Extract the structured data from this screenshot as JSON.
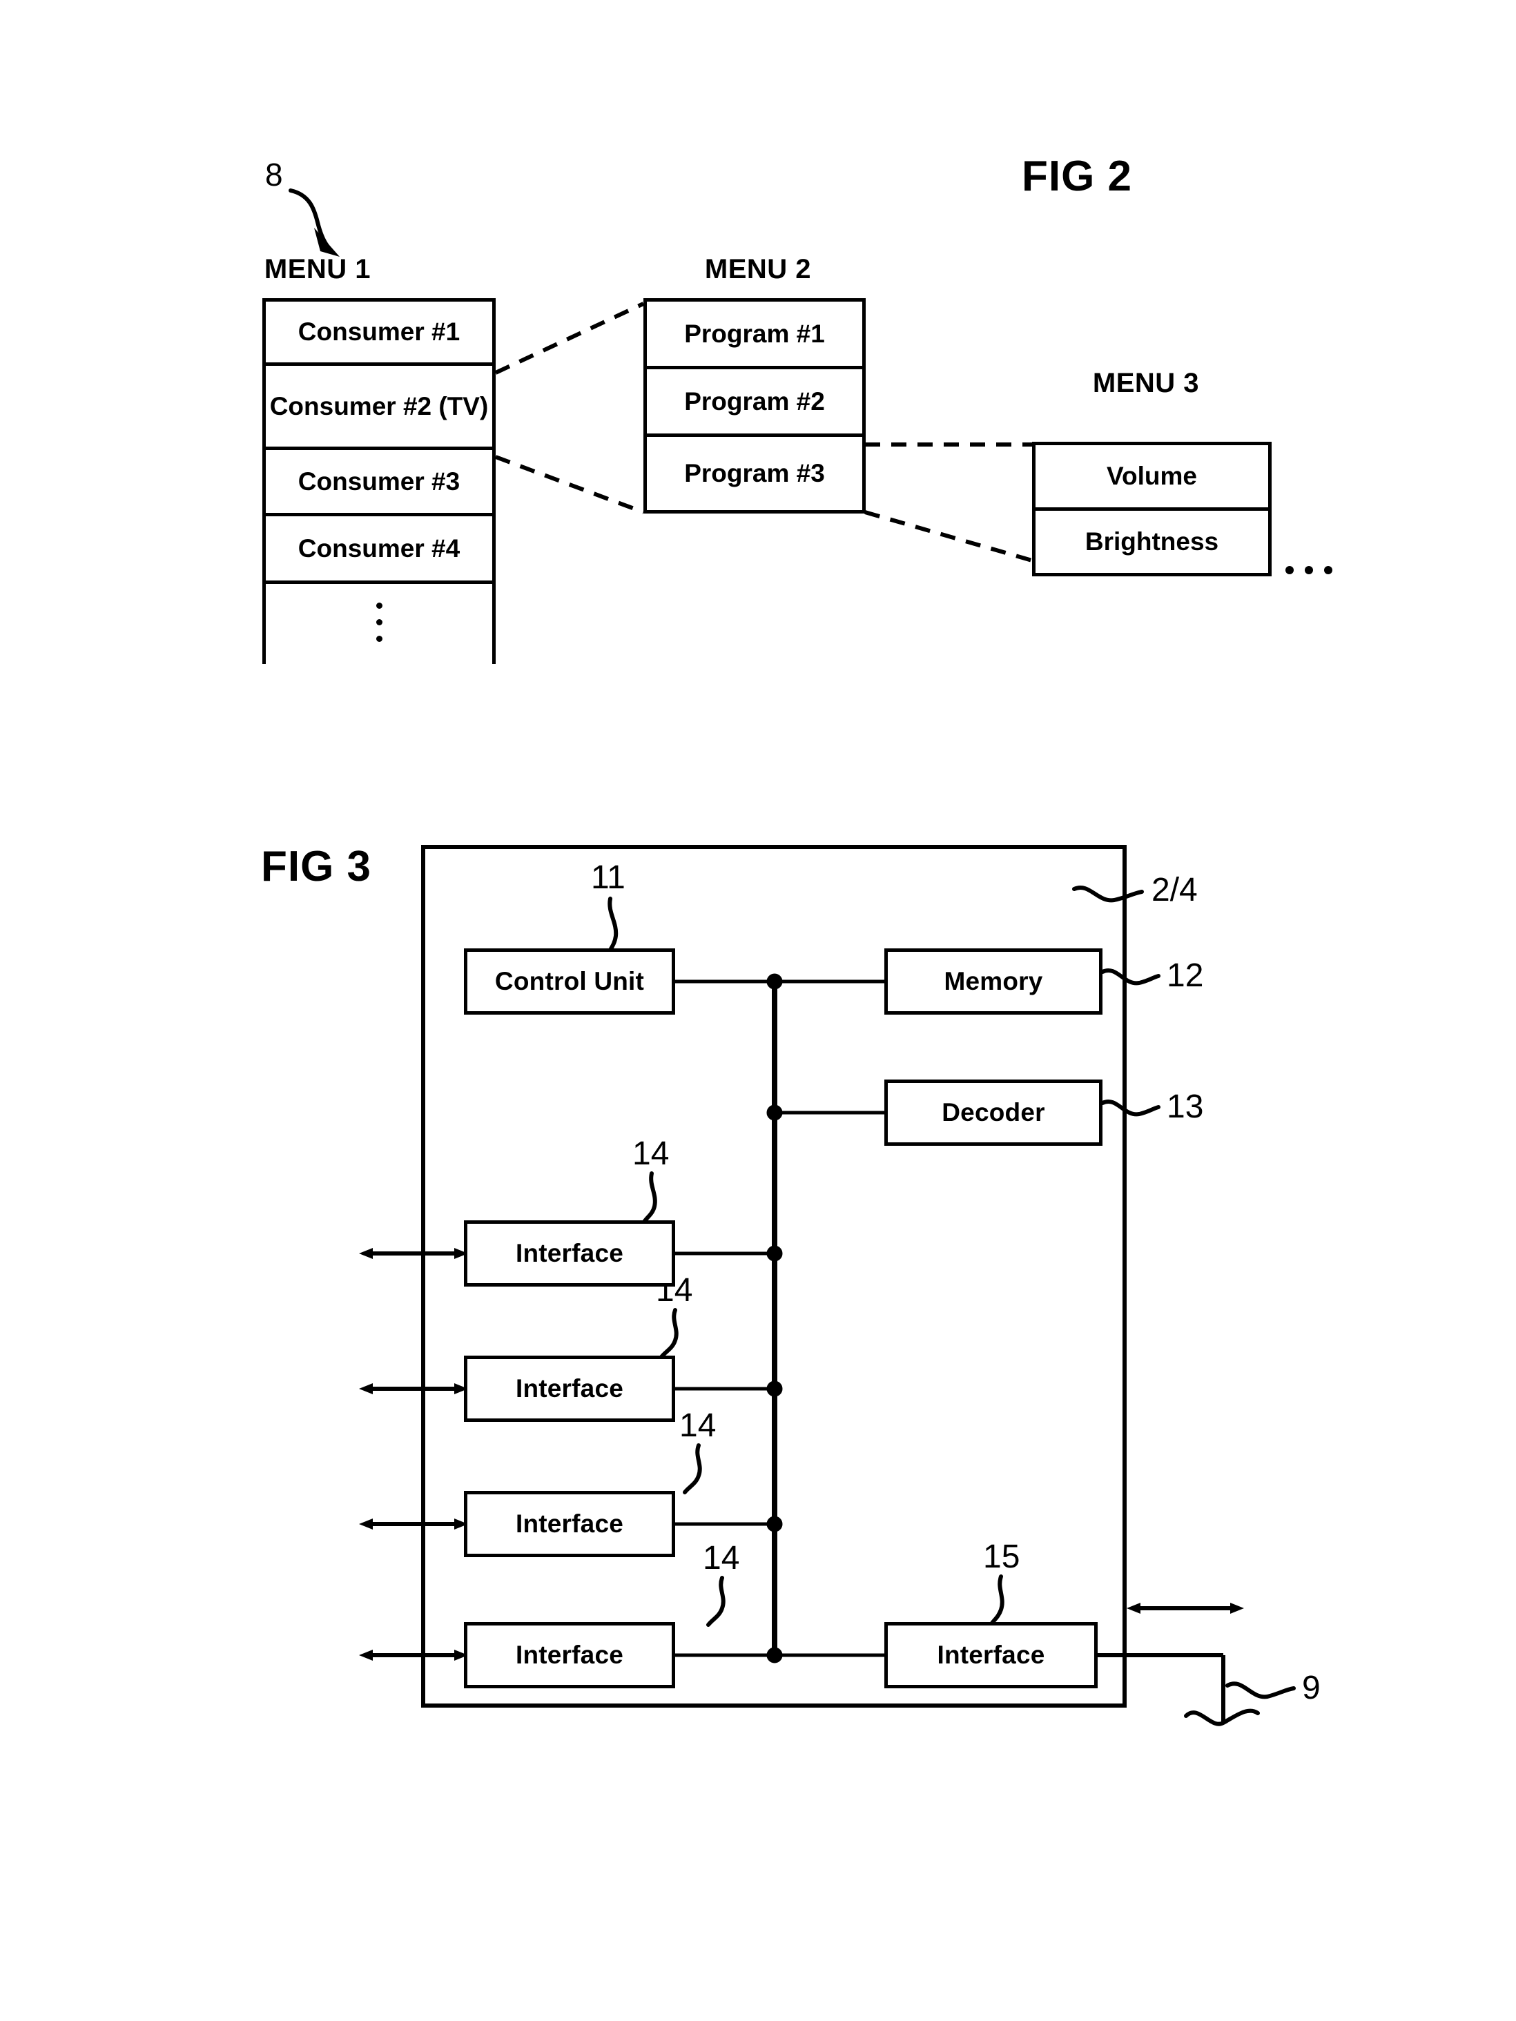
{
  "figures": [
    {
      "id": "fig2",
      "label": "FIG 2",
      "lead_ref": "8"
    },
    {
      "id": "fig3",
      "label": "FIG 3"
    }
  ],
  "fig2": {
    "label": "FIG 2",
    "lead_ref": "8",
    "menus": [
      {
        "title": "MENU 1",
        "items": [
          "Consumer #1",
          "Consumer #2\n(TV)",
          "Consumer #3",
          "Consumer #4"
        ],
        "continues": true,
        "continuation_glyph": "vertical-ellipsis"
      },
      {
        "title": "MENU 2",
        "items": [
          "Program #1",
          "Program #2",
          "Program #3"
        ],
        "continues": false
      },
      {
        "title": "MENU 3",
        "items": [
          "Volume",
          "Brightness"
        ],
        "continues": true,
        "continuation_glyph": "horizontal-ellipsis"
      }
    ]
  },
  "fig3": {
    "label": "FIG 3",
    "enclosure_ref": "2/4",
    "external_bus_ref": "9",
    "blocks": [
      {
        "name": "control-unit",
        "label": "Control Unit",
        "ref": "11"
      },
      {
        "name": "memory",
        "label": "Memory",
        "ref": "12"
      },
      {
        "name": "decoder",
        "label": "Decoder",
        "ref": "13"
      },
      {
        "name": "interface-1",
        "label": "Interface",
        "ref": "14"
      },
      {
        "name": "interface-2",
        "label": "Interface",
        "ref": "14"
      },
      {
        "name": "interface-3",
        "label": "Interface",
        "ref": "14"
      },
      {
        "name": "interface-4",
        "label": "Interface",
        "ref": "14"
      },
      {
        "name": "interface-5",
        "label": "Interface",
        "ref": "15"
      }
    ],
    "refs": {
      "control_unit": "11",
      "memory": "12",
      "decoder": "13",
      "interface_a": "14",
      "interface_b": "14",
      "interface_c": "14",
      "interface_d": "14",
      "interface_e": "15",
      "enclosure": "2/4",
      "bus": "9"
    }
  },
  "colors": {
    "ink": "#000000",
    "paper": "#ffffff"
  }
}
